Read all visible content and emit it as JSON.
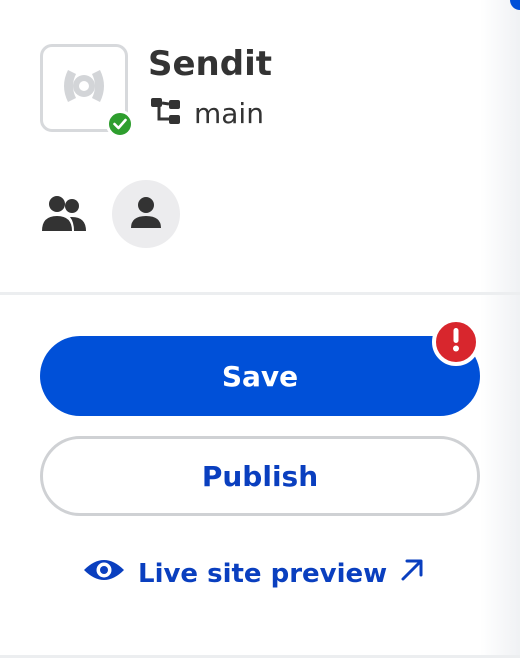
{
  "site": {
    "name": "Sendit",
    "branch": "main",
    "thumbnail_icon": "site-logo-icon",
    "status_icon": "check-icon",
    "status_color": "#2e9e2e"
  },
  "collaborators": {
    "team_icon": "users-icon",
    "avatar_icon": "user-icon"
  },
  "actions": {
    "save_label": "Save",
    "publish_label": "Publish",
    "alert_icon": "exclamation-icon",
    "alert_color": "#d8262d",
    "accent_color": "#0050d8"
  },
  "preview": {
    "label": "Live site preview",
    "leading_icon": "eye-icon",
    "trailing_icon": "external-arrow-icon"
  }
}
